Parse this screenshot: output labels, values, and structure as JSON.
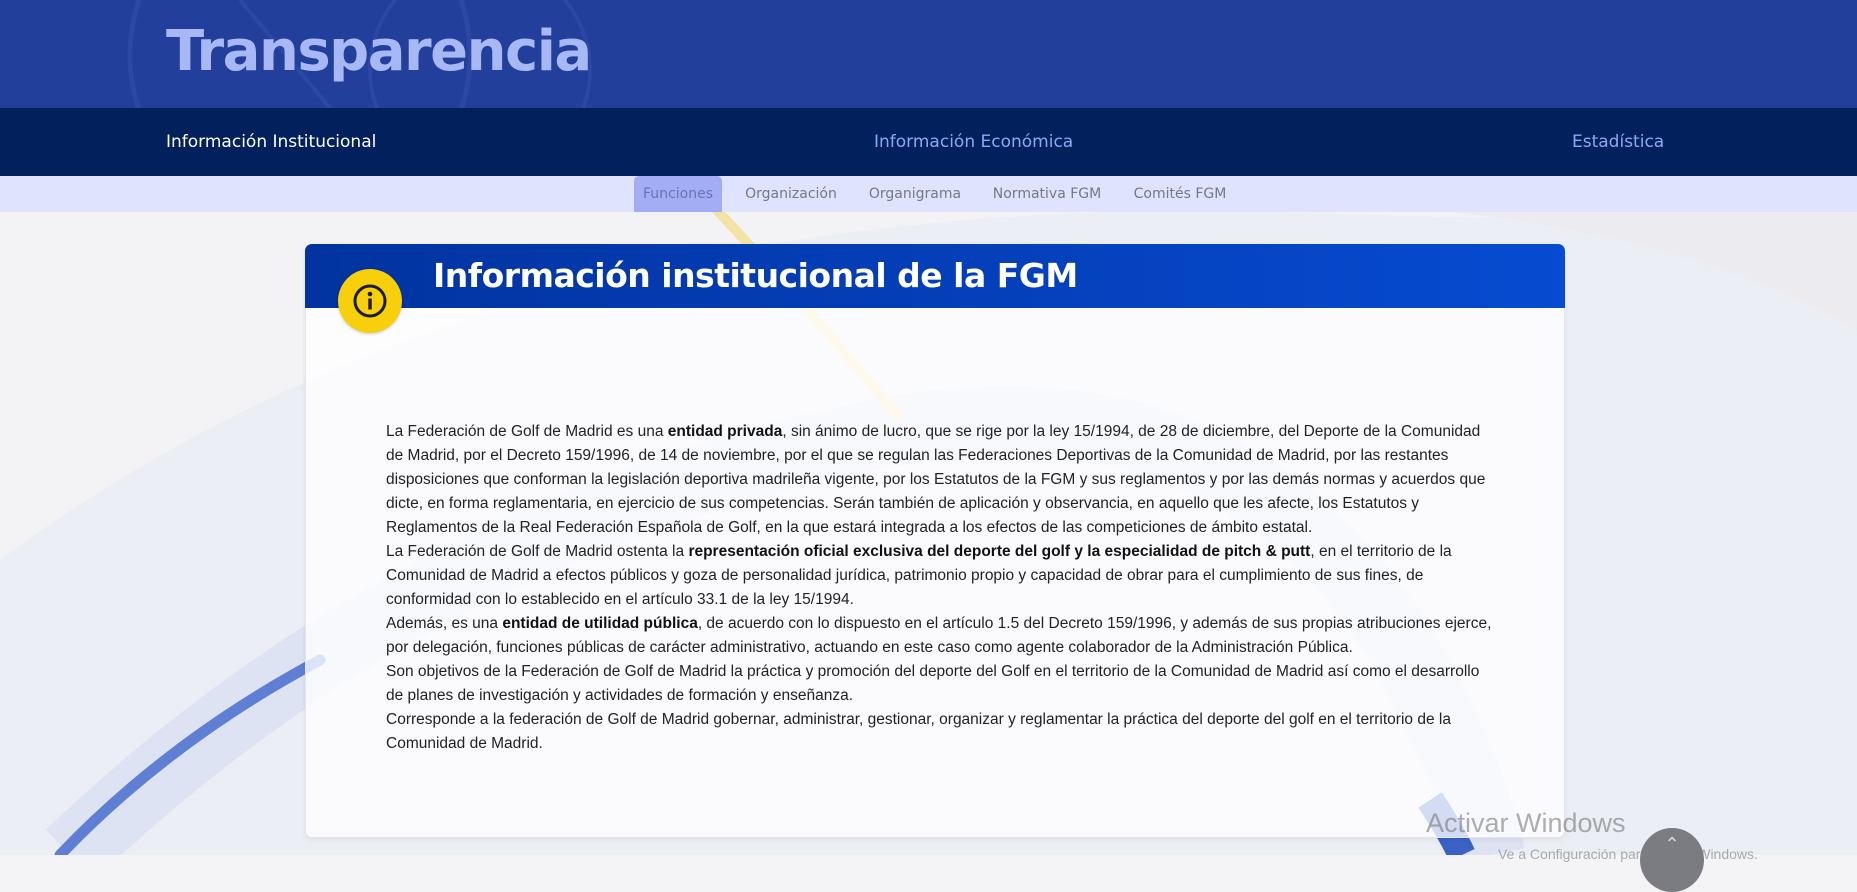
{
  "header": {
    "site_title": "Transparencia"
  },
  "main_nav": [
    {
      "label": "Información Institucional",
      "active": true
    },
    {
      "label": "Información Económica",
      "active": false
    },
    {
      "label": "Estadística",
      "active": false
    }
  ],
  "sub_nav": [
    {
      "label": "Funciones",
      "active": true
    },
    {
      "label": "Organización",
      "active": false
    },
    {
      "label": "Organigrama",
      "active": false
    },
    {
      "label": "Normativa FGM",
      "active": false
    },
    {
      "label": "Comités FGM",
      "active": false
    }
  ],
  "card": {
    "title": "Información institucional de la FGM",
    "icon": "info-icon",
    "paragraphs": [
      {
        "p1": "La Federación de Golf de Madrid es una ",
        "b1": "entidad privada",
        "p2": ", sin ánimo de lucro, que se rige por la ley 15/1994, de 28 de diciembre, del Deporte de la Comunidad de Madrid, por el Decreto 159/1996, de 14 de noviembre, por el que se regulan las Federaciones Deportivas de la Comunidad de Madrid, por las restantes disposiciones que conforman la legislación deportiva madrileña vigente, por los Estatutos de la FGM y sus reglamentos y por las demás normas y acuerdos que dicte, en forma reglamentaria, en ejercicio de sus competencias. Serán también de aplicación y observancia, en aquello que les afecte, los Estatutos y Reglamentos de la Real Federación Española de Golf, en la que estará integrada a los efectos de las competiciones de ámbito estatal."
      },
      {
        "p1": "La Federación de Golf de Madrid ostenta la ",
        "b1": "representación oficial exclusiva del deporte del golf y la especialidad de pitch & putt",
        "p2": ", en el territorio de la Comunidad de Madrid a efectos públicos y goza de personalidad jurídica, patrimonio propio y capacidad de obrar para el cumplimiento de sus fines, de conformidad con lo establecido en el artículo 33.1 de la ley 15/1994."
      },
      {
        "p1": "Además, es una ",
        "b1": "entidad de utilidad pública",
        "p2": ", de acuerdo con lo dispuesto en el artículo 1.5 del Decreto 159/1996, y además de sus propias atribuciones ejerce, por delegación, funciones públicas de carácter administrativo, actuando en este caso como agente colaborador de la Administración Pública."
      },
      {
        "p1": "Son objetivos de la Federación de Golf de Madrid la práctica y promoción del deporte del Golf  en el territorio de la Comunidad de Madrid así como el desarrollo de planes de investigación y actividades de formación y enseñanza.",
        "b1": "",
        "p2": ""
      },
      {
        "p1": "Corresponde a la federación de Golf de Madrid gobernar, administrar, gestionar, organizar y reglamentar la práctica del deporte del golf en el territorio de la Comunidad de Madrid.",
        "b1": "",
        "p2": ""
      }
    ]
  },
  "overlay": {
    "watermark": "Activar Windows",
    "watermark_sub": "Ve a Configuración para activar Windows.",
    "scroll_top_icon": "chevron-up-icon"
  },
  "colors": {
    "header_bg": "#233f9c",
    "main_nav_bg": "#01205c",
    "sub_nav_bg": "#dfe3fd",
    "accent_yellow": "#f7cf0a",
    "card_head": "#0541bd"
  }
}
